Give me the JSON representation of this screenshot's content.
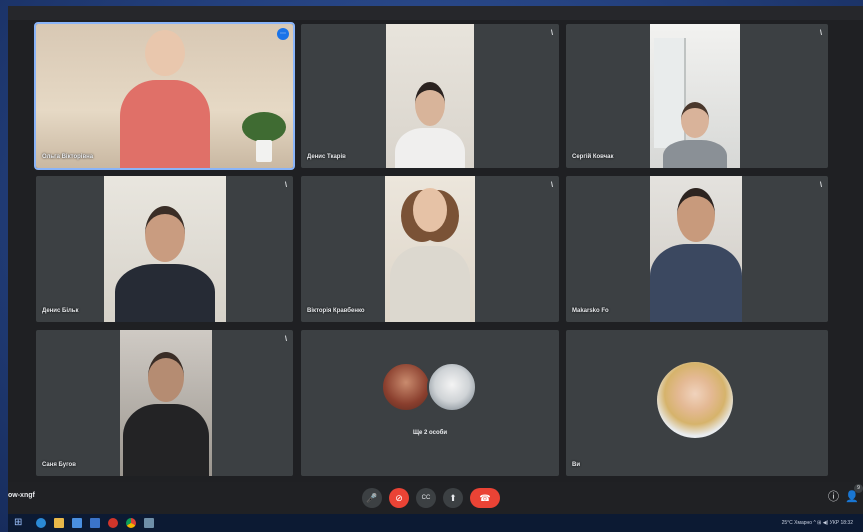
{
  "window": {
    "title_left": "",
    "title_right": ""
  },
  "tiles": [
    {
      "name": "Ольга Вікторівна",
      "mic": "",
      "pinned_badge": "⋯"
    },
    {
      "name": "Денис Ткарів",
      "mic": "\\"
    },
    {
      "name": "Сергій Ковчак",
      "mic": "\\"
    },
    {
      "name": "Денис Більк",
      "mic": "\\"
    },
    {
      "name": "Вікторія Кравбенко",
      "mic": "\\"
    },
    {
      "name": "Makarsko Fo",
      "mic": "\\"
    },
    {
      "name": "Саня Бугов",
      "mic": "\\"
    },
    {
      "name": "",
      "mic": ""
    },
    {
      "name": "Ви",
      "mic": ""
    }
  ],
  "others_group": {
    "label": "Ще 2 особи"
  },
  "meeting": {
    "code": "ow-xngf"
  },
  "controls": {
    "mic": "🎤",
    "camera": "⊘",
    "captions": "CC",
    "present": "⬆",
    "leave": "☎"
  },
  "toolbar_right": {
    "info": "ⓘ",
    "people": "👤",
    "people_count": "9"
  },
  "taskbar": {
    "start": "⊞",
    "tray_text": "25°C  Хмарно  ^  ⊞  ◀)  УКР  18:32"
  },
  "colors": {
    "accent": "#8ab4f8",
    "leave_red": "#ea4335",
    "tile_bg": "#3c4043",
    "page_bg": "#202124"
  }
}
